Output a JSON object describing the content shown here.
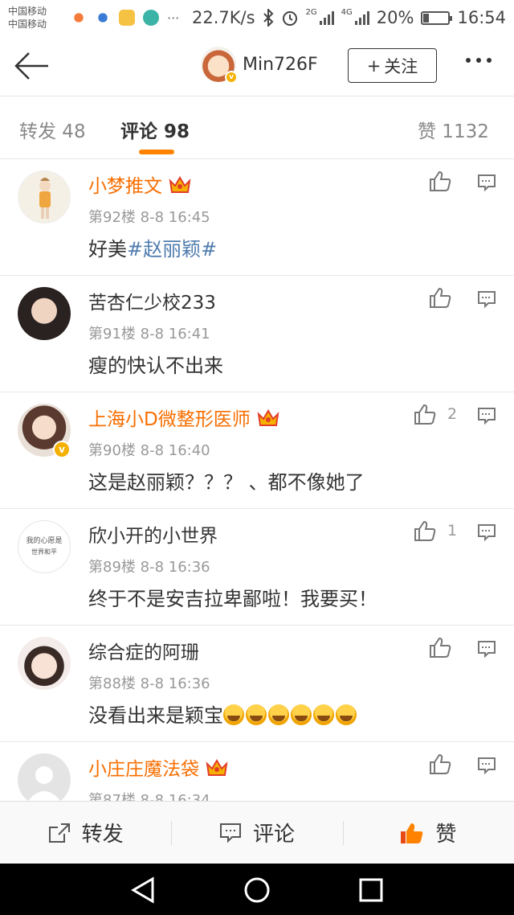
{
  "status_bar": {
    "carrier_1": "中国移动",
    "carrier_2": "中国移动",
    "app_icons": [
      "notification-icon",
      "weibo-icon",
      "app-icon",
      "graduation-icon"
    ],
    "ellipsis": "···",
    "net_speed": "22.7K/s",
    "network_2g": "2G",
    "network_4g": "4G",
    "battery": "20%",
    "battery_level": 0.2,
    "time": "16:54"
  },
  "header": {
    "username": "Min726F",
    "follow_label": "关注",
    "follow_plus": "+",
    "verified_mark": "v"
  },
  "tabs": [
    {
      "label": "转发 48",
      "active": false
    },
    {
      "label": "评论 98",
      "active": true
    },
    {
      "label": "赞 1132",
      "active": false
    }
  ],
  "avatar_text": {
    "line1": "我的心愿是",
    "line2": "世界和平"
  },
  "comments": [
    {
      "name": "小梦推文",
      "vip": true,
      "crown": true,
      "verified": false,
      "meta": "第92楼  8-8 16:45",
      "text_plain": "好美",
      "topic": "#赵丽颖#",
      "likes": "",
      "emojis": 0
    },
    {
      "name": "苦杏仁少校233",
      "vip": false,
      "crown": false,
      "verified": false,
      "meta": "第91楼  8-8 16:41",
      "text_plain": "瘦的快认不出来",
      "topic": "",
      "likes": "",
      "emojis": 0
    },
    {
      "name": "上海小D微整形医师",
      "vip": true,
      "crown": true,
      "verified": true,
      "meta": "第90楼  8-8 16:40",
      "text_plain": "这是赵丽颖？？？ 、都不像她了",
      "topic": "",
      "likes": "2",
      "emojis": 0
    },
    {
      "name": "欣小开的小世界",
      "vip": false,
      "crown": false,
      "verified": false,
      "meta": "第89楼  8-8 16:36",
      "text_plain": "终于不是安吉拉卑鄙啦！我要买！",
      "topic": "",
      "likes": "1",
      "emojis": 0
    },
    {
      "name": "综合症的阿珊",
      "vip": false,
      "crown": false,
      "verified": false,
      "meta": "第88楼  8-8 16:36",
      "text_plain": "没看出来是颖宝",
      "topic": "",
      "likes": "",
      "emojis": 6
    },
    {
      "name": "小庄庄魔法袋",
      "vip": true,
      "crown": true,
      "verified": false,
      "meta": "第87楼  8-8 16:34",
      "text_plain": "",
      "topic": "",
      "likes": "",
      "emojis": 0
    }
  ],
  "bottom_bar": {
    "repost": "转发",
    "comment": "评论",
    "like": "赞"
  },
  "colors": {
    "accent": "#ff8200",
    "vip_name": "#f86e00",
    "topic": "#507daf",
    "meta": "#999999"
  }
}
